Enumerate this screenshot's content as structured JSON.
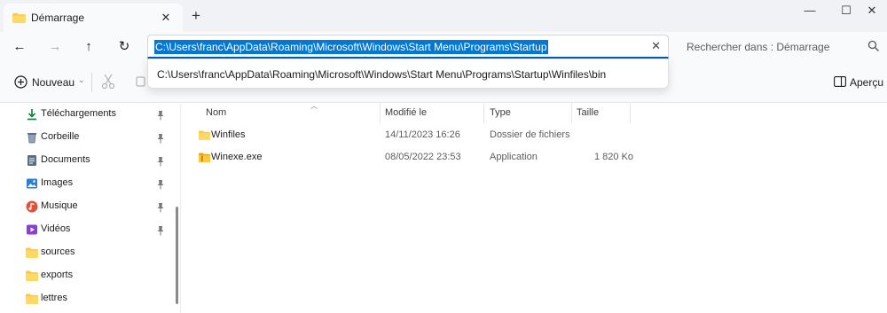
{
  "tab": {
    "title": "Démarrage",
    "close_icon": "close-icon"
  },
  "window": {
    "colors": {
      "accent": "#0078d4",
      "folder": "#ffc83d"
    }
  },
  "nav": {
    "address": "C:\\Users\\franc\\AppData\\Roaming\\Microsoft\\Windows\\Start Menu\\Programs\\Startup",
    "search_placeholder": "Rechercher dans : Démarrage"
  },
  "autocomplete": {
    "items": [
      "C:\\Users\\franc\\AppData\\Roaming\\Microsoft\\Windows\\Start Menu\\Programs\\Startup\\Winfiles\\bin"
    ]
  },
  "toolbar": {
    "new_label": "Nouveau",
    "preview_label": "Aperçu"
  },
  "sidebar": {
    "items": [
      {
        "label": "Téléchargements",
        "icon": "download-icon",
        "pinned": true
      },
      {
        "label": "Corbeille",
        "icon": "recycle-bin-icon",
        "pinned": true
      },
      {
        "label": "Documents",
        "icon": "documents-icon",
        "pinned": true
      },
      {
        "label": "Images",
        "icon": "images-icon",
        "pinned": true
      },
      {
        "label": "Musique",
        "icon": "music-icon",
        "pinned": true
      },
      {
        "label": "Vidéos",
        "icon": "videos-icon",
        "pinned": true
      },
      {
        "label": "sources",
        "icon": "folder-icon",
        "pinned": false
      },
      {
        "label": "exports",
        "icon": "folder-icon",
        "pinned": false
      },
      {
        "label": "lettres",
        "icon": "folder-icon",
        "pinned": false
      }
    ]
  },
  "files": {
    "columns": [
      "Nom",
      "Modifié le",
      "Type",
      "Taille"
    ],
    "rows": [
      {
        "name": "Winfiles",
        "modified": "14/11/2023 16:26",
        "type": "Dossier de fichiers",
        "size": "",
        "icon": "folder-icon"
      },
      {
        "name": "Winexe.exe",
        "modified": "08/05/2022 23:53",
        "type": "Application",
        "size": "1 820 Ko",
        "icon": "application-icon"
      }
    ]
  }
}
